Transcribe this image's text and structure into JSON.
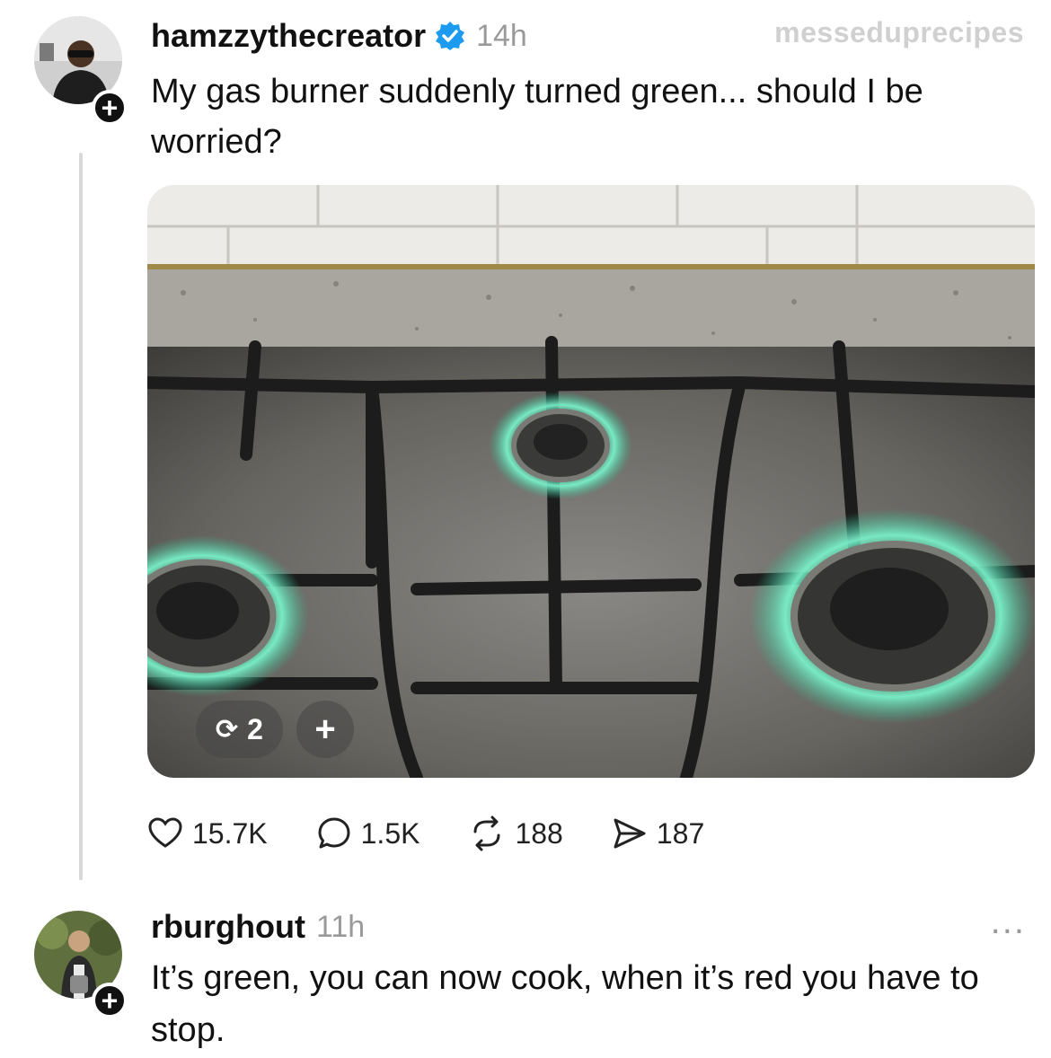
{
  "post": {
    "username": "hamzzythecreator",
    "verified_icon": "verified-badge-icon",
    "time": "14h",
    "watermark": "messeduprecipes",
    "text": "My gas burner suddenly turned green... should I be worried?",
    "media": {
      "counter": "2",
      "add_label": "+"
    },
    "stats": {
      "likes": "15.7K",
      "comments": "1.5K",
      "reposts": "188",
      "shares": "187"
    }
  },
  "reply": {
    "username": "rburghout",
    "time": "11h",
    "more_label": "...",
    "text": "It’s green, you can now cook, when it’s red you have to stop."
  },
  "follow_label": "+",
  "colors": {
    "flame": "#3fd6a8",
    "verified": "#1d9bf0",
    "muted": "#9a9a9a"
  }
}
